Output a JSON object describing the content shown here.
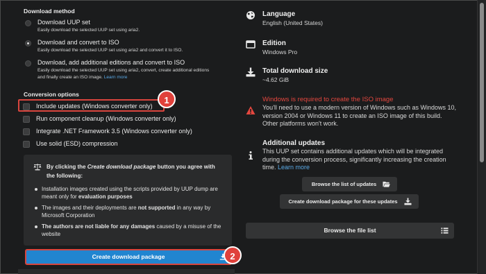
{
  "download_method": {
    "heading": "Download method",
    "options": [
      {
        "label": "Download UUP set",
        "desc1": "Easily download the selected UUP set using aria2.",
        "desc2": "",
        "link": "",
        "checked": false
      },
      {
        "label": "Download and convert to ISO",
        "desc1": "Easily download the selected UUP set using aria2 and convert it to ISO.",
        "desc2": "",
        "link": "",
        "checked": true
      },
      {
        "label": "Download, add additional editions and convert to ISO",
        "desc1": "Easily download the selected UUP set using aria2, convert, create additional editions",
        "desc2": "and finally create an ISO image.",
        "link": "Learn more",
        "checked": false
      }
    ]
  },
  "conversion_options": {
    "heading": "Conversion options",
    "items": [
      {
        "label": "Include updates (Windows converter only)"
      },
      {
        "label": "Run component cleanup (Windows converter only)"
      },
      {
        "label": "Integrate .NET Framework 3.5 (Windows converter only)"
      },
      {
        "label": "Use solid (ESD) compression"
      }
    ]
  },
  "notice": {
    "head_pre": "By clicking the ",
    "head_em": "Create download package",
    "head_post": " button you agree with the following:",
    "bullet1_pre": "Installation images created using the scripts provided by UUP dump are meant only for ",
    "bullet1_bold": "evaluation purposes",
    "bullet2_pre": "The images and their deployments are ",
    "bullet2_bold": "not supported",
    "bullet2_post": " in any way by Microsoft Corporation",
    "bullet3_bold": "The authors are not liable for any damages",
    "bullet3_post": " caused by a misuse of the website"
  },
  "create_button": "Create download package",
  "badges": {
    "one": "1",
    "two": "2"
  },
  "info": {
    "language_title": "Language",
    "language_value": "English (United States)",
    "edition_title": "Edition",
    "edition_value": "Windows Pro",
    "size_title": "Total download size",
    "size_value": "~4.62 GiB",
    "warning_title": "Windows is required to create the ISO image",
    "warning_text": "You'll need to use a modern version of Windows such as Windows 10, version 2004 or Windows 11 to create an ISO image of this build. Other platforms won't work.",
    "updates_title": "Additional updates",
    "updates_text": "This UUP set contains additional updates which will be integrated during the conversion process, significantly increasing the creation time.",
    "updates_link": "Learn more"
  },
  "buttons": {
    "browse_updates": "Browse the list of updates",
    "create_for_updates": "Create download package for these updates",
    "browse_files": "Browse the file list"
  },
  "colors": {
    "accent": "#2185d0",
    "warning": "#e4473f",
    "callout": "#e0413b",
    "link": "#5aa9e6"
  }
}
